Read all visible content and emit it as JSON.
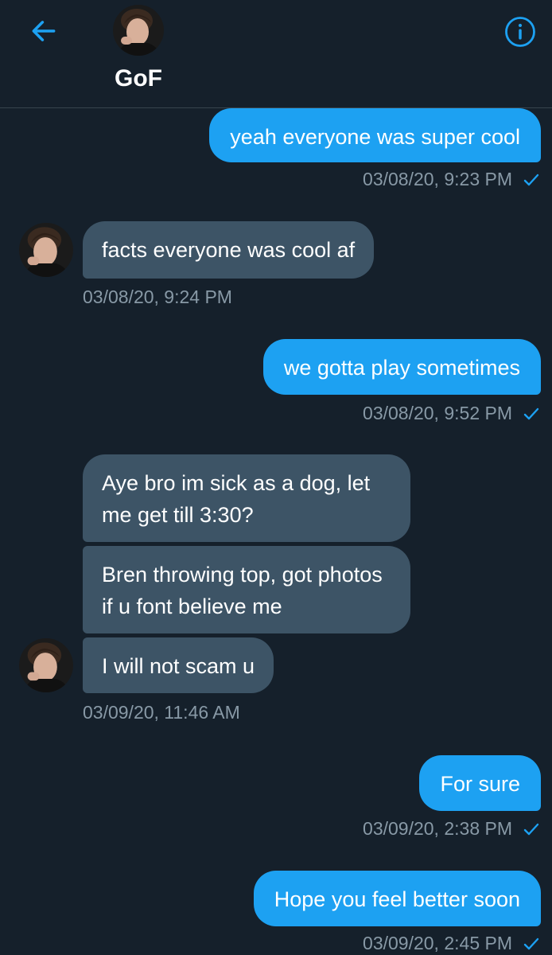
{
  "header": {
    "name": "GoF",
    "back_icon": "arrow-left-icon",
    "info_icon": "info-circle-icon",
    "accent_color": "#1da1f2"
  },
  "messages": [
    {
      "direction": "out",
      "text": "yeah everyone was super cool",
      "time": "03/08/20, 9:23 PM",
      "read": true
    },
    {
      "direction": "in",
      "text": "facts everyone was cool af",
      "time": "03/08/20, 9:24 PM"
    },
    {
      "direction": "out",
      "text": "we gotta play sometimes",
      "time": "03/08/20, 9:52 PM",
      "read": true
    },
    {
      "direction": "in",
      "text": "Aye bro im sick as a dog, let me get till 3:30?"
    },
    {
      "direction": "in",
      "text": "Bren throwing top, got photos if u font believe me"
    },
    {
      "direction": "in",
      "text": "I will not scam u",
      "time": "03/09/20, 11:46 AM"
    },
    {
      "direction": "out",
      "text": "For sure",
      "time": "03/09/20, 2:38 PM",
      "read": true
    },
    {
      "direction": "out",
      "text": "Hope you feel better soon",
      "time": "03/09/20, 2:45 PM",
      "read": true
    }
  ],
  "colors": {
    "background": "#15202b",
    "outgoing_bubble": "#1da1f2",
    "incoming_bubble": "#3d5466",
    "meta_text": "#8899a6"
  }
}
